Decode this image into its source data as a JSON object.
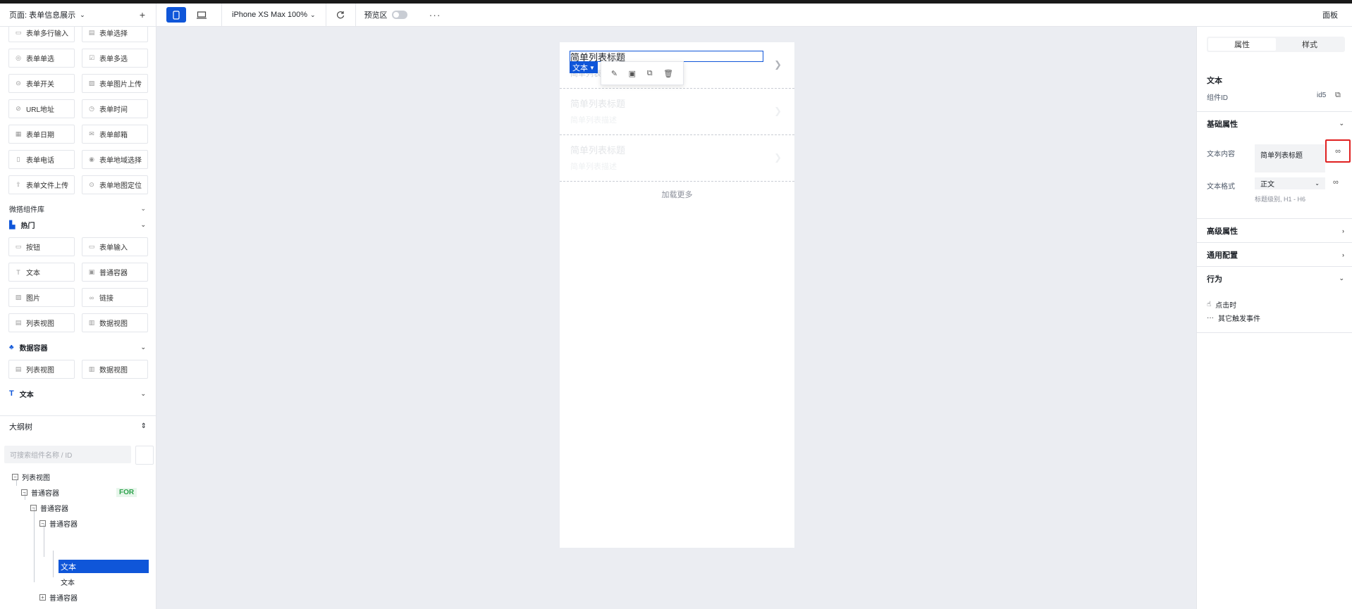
{
  "topbar": {
    "page_label": "页面: 表单信息展示",
    "add": "+",
    "device_model": "iPhone XS Max 100%",
    "preview_label": "预览区",
    "more": "···",
    "panel_label": "面板"
  },
  "components": {
    "form_items": [
      "表单多行输入",
      "表单选择",
      "表单单选",
      "表单多选",
      "表单开关",
      "表单图片上传",
      "URL地址",
      "表单时间",
      "表单日期",
      "表单邮箱",
      "表单电话",
      "表单地域选择",
      "表单文件上传",
      "表单地图定位"
    ],
    "library_title": "微搭组件库",
    "hot_title": "热门",
    "hot_items": [
      "按钮",
      "表单输入",
      "文本",
      "普通容器",
      "图片",
      "链接",
      "列表视图",
      "数据视图"
    ],
    "data_container_title": "数据容器",
    "data_items": [
      "列表视图",
      "数据视图"
    ],
    "text_title": "文本"
  },
  "outline": {
    "title": "大纲树",
    "search_placeholder": "可搜索组件名称 / ID",
    "nodes": [
      "列表视图",
      "普通容器",
      "普通容器",
      "普通容器",
      "文本",
      "文本",
      "普通容器"
    ],
    "for_tag": "FOR"
  },
  "canvas": {
    "items": [
      {
        "title": "简单列表标题",
        "subtitle": "简单列表描述"
      },
      {
        "title": "简单列表标题",
        "subtitle": "简单列表描述"
      },
      {
        "title": "简单列表标题",
        "subtitle": "简单列表描述"
      }
    ],
    "selected_tag": "文本",
    "load_more": "加载更多"
  },
  "props": {
    "tab_props": "属性",
    "tab_style": "样式",
    "component_title": "文本",
    "id_label": "组件ID",
    "id_value": "id5",
    "basic_title": "基础属性",
    "text_content_label": "文本内容",
    "text_content_value": "简单列表标题",
    "text_format_label": "文本格式",
    "text_format_value": "正文",
    "format_hint": "标题级别, H1 - H6",
    "advanced_title": "高级属性",
    "general_title": "通用配置",
    "behavior_title": "行为",
    "on_click": "点击时",
    "other_events": "其它触发事件"
  },
  "colors": {
    "accent": "#0f56d9",
    "highlight": "#e02020",
    "tag_green": "#2ba14a"
  }
}
